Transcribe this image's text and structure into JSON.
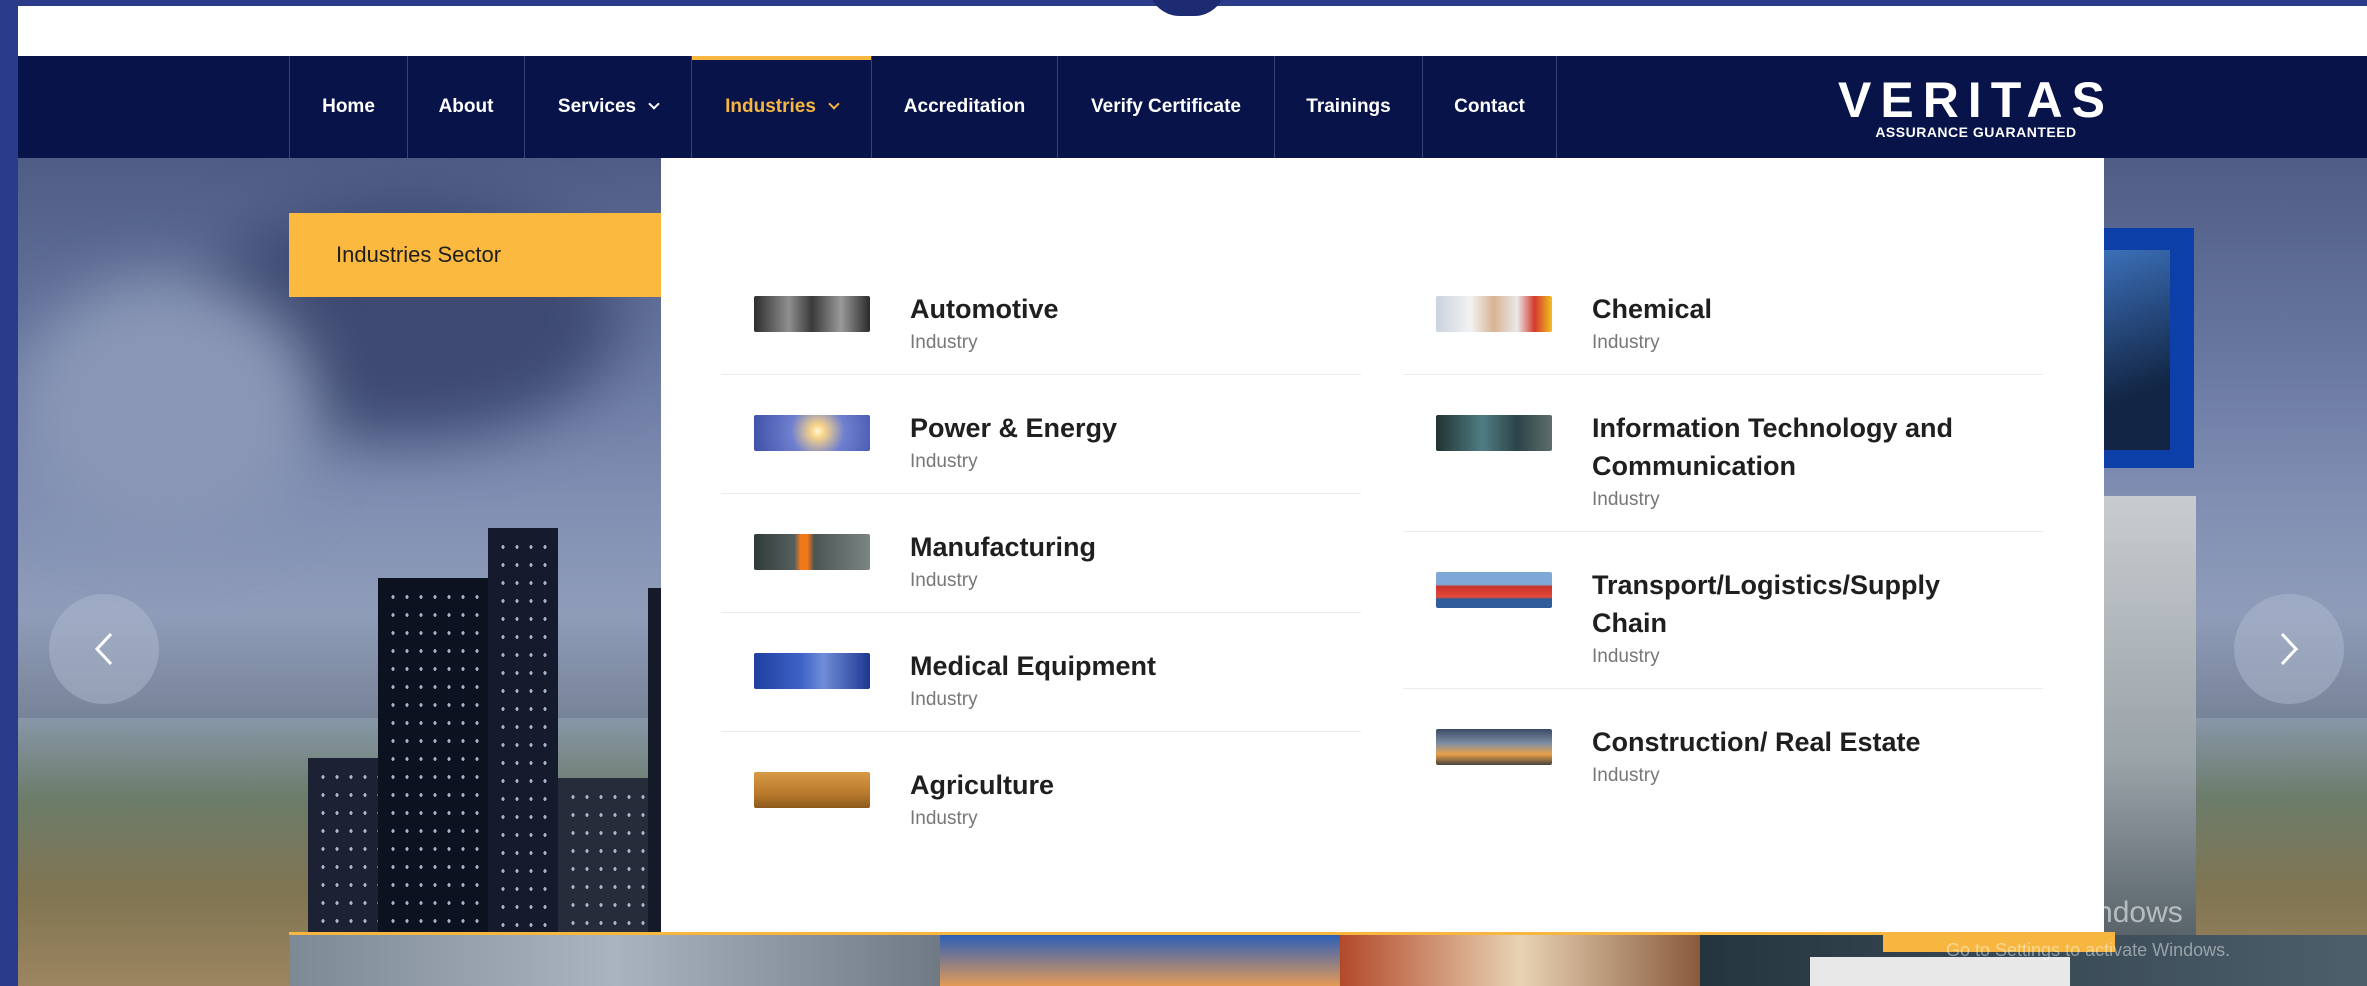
{
  "nav": {
    "items": [
      {
        "label": "Home",
        "has_caret": false,
        "active": false
      },
      {
        "label": "About",
        "has_caret": false,
        "active": false
      },
      {
        "label": "Services",
        "has_caret": true,
        "active": false
      },
      {
        "label": "Industries",
        "has_caret": true,
        "active": true
      },
      {
        "label": "Accreditation",
        "has_caret": false,
        "active": false
      },
      {
        "label": "Verify Certificate",
        "has_caret": false,
        "active": false
      },
      {
        "label": "Trainings",
        "has_caret": false,
        "active": false
      },
      {
        "label": "Contact",
        "has_caret": false,
        "active": false
      }
    ]
  },
  "logo": {
    "word": "VERITAS",
    "tagline": "ASSURANCE GUARANTEED"
  },
  "mega_menu": {
    "sector_label": "Industries Sector",
    "left_column": [
      {
        "title": "Automotive",
        "sub": "Industry",
        "thumb": "automotive-thumb"
      },
      {
        "title": "Power & Energy",
        "sub": "Industry",
        "thumb": "power-energy-thumb"
      },
      {
        "title": "Manufacturing",
        "sub": "Industry",
        "thumb": "manufacturing-thumb"
      },
      {
        "title": "Medical Equipment",
        "sub": "Industry",
        "thumb": "medical-equipment-thumb"
      },
      {
        "title": "Agriculture",
        "sub": "Industry",
        "thumb": "agriculture-thumb"
      }
    ],
    "right_column": [
      {
        "title": "Chemical",
        "sub": "Industry",
        "thumb": "chemical-thumb"
      },
      {
        "title": "Information Technology and Communication",
        "sub": "Industry",
        "thumb": "it-communication-thumb"
      },
      {
        "title": "Transport/Logistics/Supply Chain",
        "sub": "Industry",
        "thumb": "transport-logistics-thumb"
      },
      {
        "title": "Construction/ Real Estate",
        "sub": "Industry",
        "thumb": "construction-thumb"
      }
    ]
  },
  "carousel": {
    "prev_icon": "chevron-left-icon",
    "next_icon": "chevron-right-icon"
  },
  "watermark": {
    "title": "Activate Windows",
    "sub": "Go to Settings to activate Windows."
  },
  "colors": {
    "navbar": "#071349",
    "accent": "#f6b63f",
    "frame": "#2a3b8a"
  }
}
